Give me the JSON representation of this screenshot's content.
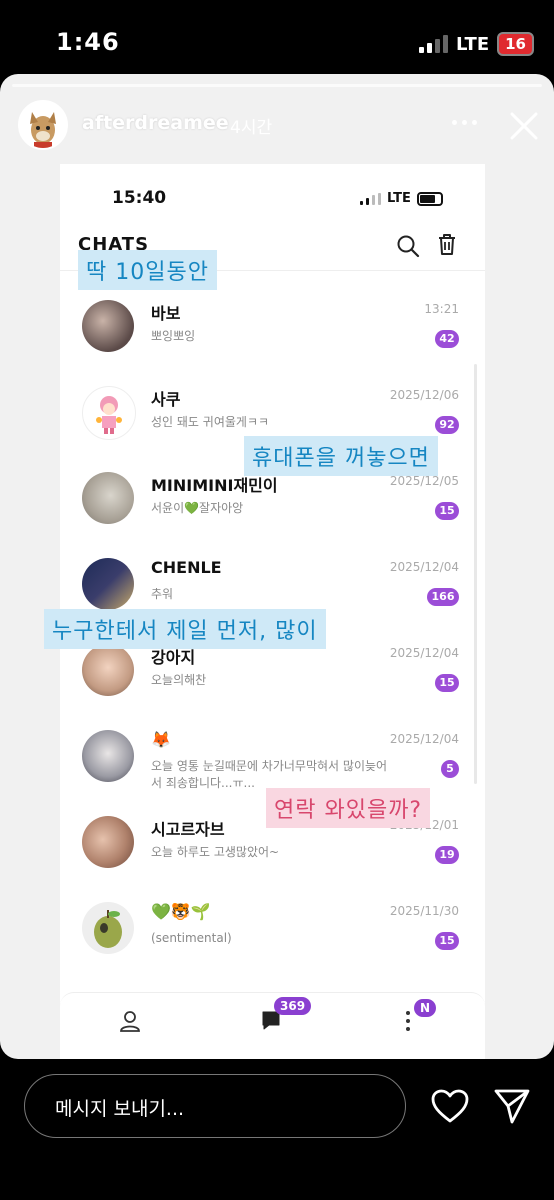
{
  "status_bar": {
    "time": "1:46",
    "network": "LTE",
    "battery": "16"
  },
  "story": {
    "username": "afterdreamee",
    "time": "4시간"
  },
  "inner": {
    "status": {
      "time": "15:40",
      "network": "LTE"
    },
    "title": "CHATS",
    "chats": [
      {
        "name": "바보",
        "preview": "뽀잉뽀잉",
        "date": "13:21",
        "badge": "42"
      },
      {
        "name": "사쿠",
        "preview": "성인 돼도 귀여울게ㅋㅋ",
        "date": "2025/12/06",
        "badge": "92"
      },
      {
        "name": "MINIMINI재민이",
        "preview": "서윤이💚잘자아앙",
        "date": "2025/12/05",
        "badge": "15"
      },
      {
        "name": "CHENLE",
        "preview": "추워",
        "date": "2025/12/04",
        "badge": "166"
      },
      {
        "name": "강아지",
        "preview": "오늘의해찬",
        "date": "2025/12/04",
        "badge": "15"
      },
      {
        "name": "🦊",
        "preview": "오늘 영통 눈길때문에 차가너무막혀서 많이늦어서 죄송합니다...ㅠ...",
        "date": "2025/12/04",
        "badge": "5"
      },
      {
        "name": "시고르자브",
        "preview": "오늘 하루도 고생많았어~",
        "date": "2025/12/01",
        "badge": "19"
      },
      {
        "name": "💚🐯🌱",
        "preview": "(sentimental)",
        "date": "2025/11/30",
        "badge": "15"
      }
    ],
    "nav": {
      "chat_badge": "369",
      "more_badge": "N"
    }
  },
  "stickers": {
    "s1": "딱 10일동안",
    "s2": "휴대폰을 꺼놓으면",
    "s3": "누구한테서 제일 먼저, 많이",
    "s4": "연락 와있을까?"
  },
  "reply": {
    "placeholder": "메시지 보내기..."
  },
  "colors": {
    "badge": "#9b4dd7",
    "sticker_blue_bg": "#cfe9f7",
    "sticker_blue_text": "#1686c2",
    "sticker_pink_bg": "#f9d7e1",
    "sticker_pink_text": "#d8476d"
  }
}
